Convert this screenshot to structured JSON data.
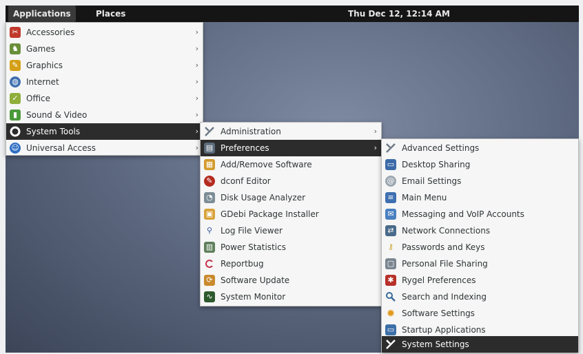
{
  "topbar": {
    "applications": "Applications",
    "places": "Places",
    "clock": "Thu Dec 12, 12:14 AM"
  },
  "main_menu": {
    "items": [
      {
        "label": "Accessories",
        "icon": "accessories-icon",
        "color": "#c0392b"
      },
      {
        "label": "Games",
        "icon": "games-icon",
        "color": "#6a8f3a"
      },
      {
        "label": "Graphics",
        "icon": "graphics-icon",
        "color": "#d4a017"
      },
      {
        "label": "Internet",
        "icon": "internet-icon",
        "color": "#3f6fb0"
      },
      {
        "label": "Office",
        "icon": "office-icon",
        "color": "#8fae3a"
      },
      {
        "label": "Sound & Video",
        "icon": "sound-video-icon",
        "color": "#4a9a3a"
      },
      {
        "label": "System Tools",
        "icon": "system-tools-icon",
        "color": "#ffffff"
      },
      {
        "label": "Universal Access",
        "icon": "universal-access-icon",
        "color": "#2f6ec2"
      }
    ]
  },
  "system_tools_menu": {
    "items": [
      {
        "label": "Administration",
        "icon": "administration-icon",
        "color": "#6d7a86"
      },
      {
        "label": "Preferences",
        "icon": "preferences-icon",
        "color": "#5a6a7a"
      },
      {
        "label": "Add/Remove Software",
        "icon": "add-remove-software-icon",
        "color": "#d39a2c"
      },
      {
        "label": "dconf Editor",
        "icon": "dconf-editor-icon",
        "color": "#b52a1f"
      },
      {
        "label": "Disk Usage Analyzer",
        "icon": "disk-usage-analyzer-icon",
        "color": "#7d8d96"
      },
      {
        "label": "GDebi Package Installer",
        "icon": "gdebi-package-installer-icon",
        "color": "#d8a23a"
      },
      {
        "label": "Log File Viewer",
        "icon": "log-file-viewer-icon",
        "color": "#2c4f99"
      },
      {
        "label": "Power Statistics",
        "icon": "power-statistics-icon",
        "color": "#5e7f5a"
      },
      {
        "label": "Reportbug",
        "icon": "reportbug-icon",
        "color": "#c2334a"
      },
      {
        "label": "Software Update",
        "icon": "software-update-icon",
        "color": "#c98a2e"
      },
      {
        "label": "System Monitor",
        "icon": "system-monitor-icon",
        "color": "#2d5a2d"
      }
    ]
  },
  "preferences_menu": {
    "items": [
      {
        "label": "Advanced Settings",
        "icon": "advanced-settings-icon",
        "color": "#6d7a86"
      },
      {
        "label": "Desktop Sharing",
        "icon": "desktop-sharing-icon",
        "color": "#3c6aa8"
      },
      {
        "label": "Email Settings",
        "icon": "email-settings-icon",
        "color": "#9aa6b0"
      },
      {
        "label": "Main Menu",
        "icon": "main-menu-icon",
        "color": "#3f6fb0"
      },
      {
        "label": "Messaging and VoIP Accounts",
        "icon": "messaging-voip-icon",
        "color": "#4a80c0"
      },
      {
        "label": "Network Connections",
        "icon": "network-connections-icon",
        "color": "#4a6b8a"
      },
      {
        "label": "Passwords and Keys",
        "icon": "passwords-keys-icon",
        "color": "#c9a227"
      },
      {
        "label": "Personal File Sharing",
        "icon": "personal-file-sharing-icon",
        "color": "#7a8590"
      },
      {
        "label": "Rygel Preferences",
        "icon": "rygel-preferences-icon",
        "color": "#b8302a"
      },
      {
        "label": "Search and Indexing",
        "icon": "search-indexing-icon",
        "color": "#3a6a9a"
      },
      {
        "label": "Software Settings",
        "icon": "software-settings-icon",
        "color": "#e39a1c"
      },
      {
        "label": "Startup Applications",
        "icon": "startup-applications-icon",
        "color": "#3d6fa8"
      },
      {
        "label": "System Settings",
        "icon": "system-settings-icon",
        "color": "#ffffff"
      }
    ]
  }
}
